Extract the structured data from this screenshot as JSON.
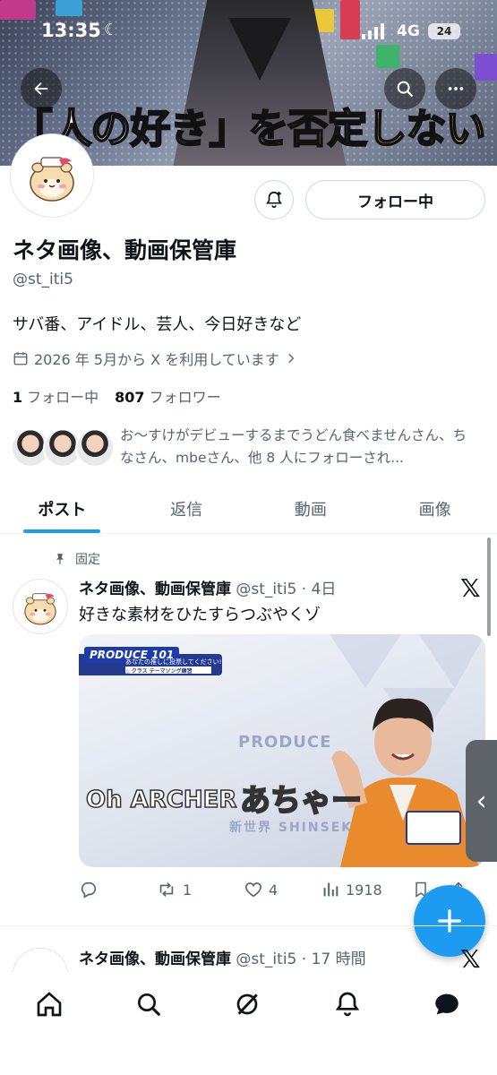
{
  "status_bar": {
    "time": "13:35",
    "network": "4G",
    "battery": "24"
  },
  "banner": {
    "caption_parts": [
      {
        "text": "「人の好き」を",
        "style": "w"
      },
      {
        "text": "否定しない",
        "style": "y"
      }
    ]
  },
  "header": {
    "back_icon": "arrow-left-icon",
    "search_icon": "search-icon",
    "more_icon": "more-icon"
  },
  "profile": {
    "name": "ネタ画像、動画保管庫",
    "handle": "@st_iti5",
    "bio": "サバ番、アイドル、芸人、今日好きなど",
    "joined": "2026 年 5月から X を利用しています",
    "following_count": "1",
    "following_label": "フォロー中",
    "followers_count": "807",
    "followers_label": "フォロワー",
    "follow_button_label": "フォロー中",
    "followed_by_text": "お〜すけがデビューするまでうどん食べませんさん、ち なさん、mbeさん、他 8 人にフォローされ..."
  },
  "tabs": [
    {
      "label": "ポスト",
      "active": true
    },
    {
      "label": "返信",
      "active": false
    },
    {
      "label": "動画",
      "active": false
    },
    {
      "label": "画像",
      "active": false
    }
  ],
  "pinned_post": {
    "pinned_label": "固定",
    "author": "ネタ画像、動画保管庫",
    "handle_time": "@st_iti5 · 4日",
    "text": "好きな素材をひたすらつぶやくゾ",
    "media": {
      "hud_top": "あなたの推しに投票してください!",
      "hud_sub": "△ クラス テーマソング練習",
      "logo": "PRODUCE 101",
      "watermark_top": "PRODUCE",
      "watermark_bottom": "新世界 SHINSEKAI",
      "caption_left": "Oh ARCHER",
      "caption_right": "あちゃー"
    },
    "actions": {
      "replies": "",
      "reposts": "1",
      "likes": "4",
      "views": "1918"
    }
  },
  "next_post": {
    "author": "ネタ画像、動画保管庫",
    "handle_time": "@st_iti5 · 17 時間"
  },
  "colors": {
    "accent": "#1d9bf0",
    "text": "#0f1419",
    "muted": "#536471"
  }
}
